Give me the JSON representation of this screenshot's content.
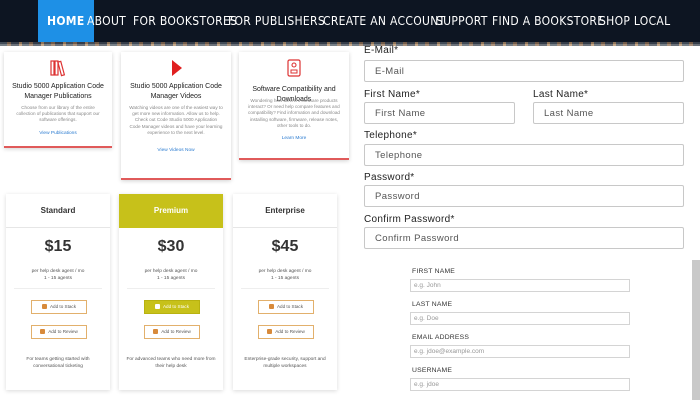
{
  "nav": {
    "items": [
      "HOME",
      "ABOUT",
      "FOR BOOKSTORES",
      "FOR PUBLISHERS",
      "CREATE AN ACCOUNT",
      "SUPPORT",
      "FIND A BOOKSTORE",
      "SHOP LOCAL"
    ],
    "active": "HOME"
  },
  "features": [
    {
      "icon": "books-icon",
      "title": "Studio 5000 Application Code Manager Publications",
      "desc": "Choose from our library of the entire collection of publications that support our software offerings.",
      "link": "View Publications"
    },
    {
      "icon": "play-icon",
      "title": "Studio 5000 Application Code Manager Videos",
      "desc": "Watching videos are one of the easiest way to get more new information. Allow us to help. Check out Code Studio 5000 Application Code Manager videos and have your learning experience to the next level.",
      "link": "View Videos Now"
    },
    {
      "icon": "compatibility-icon",
      "title": "Software Compatibility and Downloads",
      "desc": "Wondering how different software products interact? Or need help compare features and compatibility? Find information and download installing software, firmware, release notes, other tools to do.",
      "link": "Learn More"
    }
  ],
  "pricing": [
    {
      "name": "Standard",
      "price": "$15",
      "unit": "per help desk agent / mo",
      "agents": "1 - 15 agents",
      "btn1": "Add to Stack",
      "btn2": "Add to Review",
      "desc": "For teams getting started with conversational ticketing"
    },
    {
      "name": "Premium",
      "price": "$30",
      "unit": "per help desk agent / mo",
      "agents": "1 - 15 agents",
      "btn1": "Add to Stack",
      "btn2": "Add to Review",
      "desc": "For advanced teams who need more from their help desk"
    },
    {
      "name": "Enterprise",
      "price": "$45",
      "unit": "per help desk agent / mo",
      "agents": "1 - 15 agents",
      "btn1": "Add to Stack",
      "btn2": "Add to Review",
      "desc": "Enterprise-grade security, support and multiple workspaces"
    }
  ],
  "form": {
    "email_label": "E-Mail*",
    "email_placeholder": "E-Mail",
    "first_label": "First Name*",
    "first_placeholder": "First Name",
    "last_label": "Last Name*",
    "last_placeholder": "Last Name",
    "phone_label": "Telephone*",
    "phone_placeholder": "Telephone",
    "password_label": "Password*",
    "password_placeholder": "Password",
    "confirm_label": "Confirm Password*",
    "confirm_placeholder": "Confirm Password"
  },
  "signup": {
    "first_label": "FIRST NAME",
    "first_placeholder": "e.g. John",
    "last_label": "LAST NAME",
    "last_placeholder": "e.g. Doe",
    "email_label": "EMAIL ADDRESS",
    "email_placeholder": "e.g. jdoe@example.com",
    "username_label": "USERNAME",
    "username_placeholder": "e.g. jdoe"
  },
  "colors": {
    "nav_bg": "#0d1522",
    "nav_active": "#1e90e6",
    "accent_red": "#e05a5a",
    "premium": "#c7c11a",
    "link": "#2a7bd0"
  }
}
